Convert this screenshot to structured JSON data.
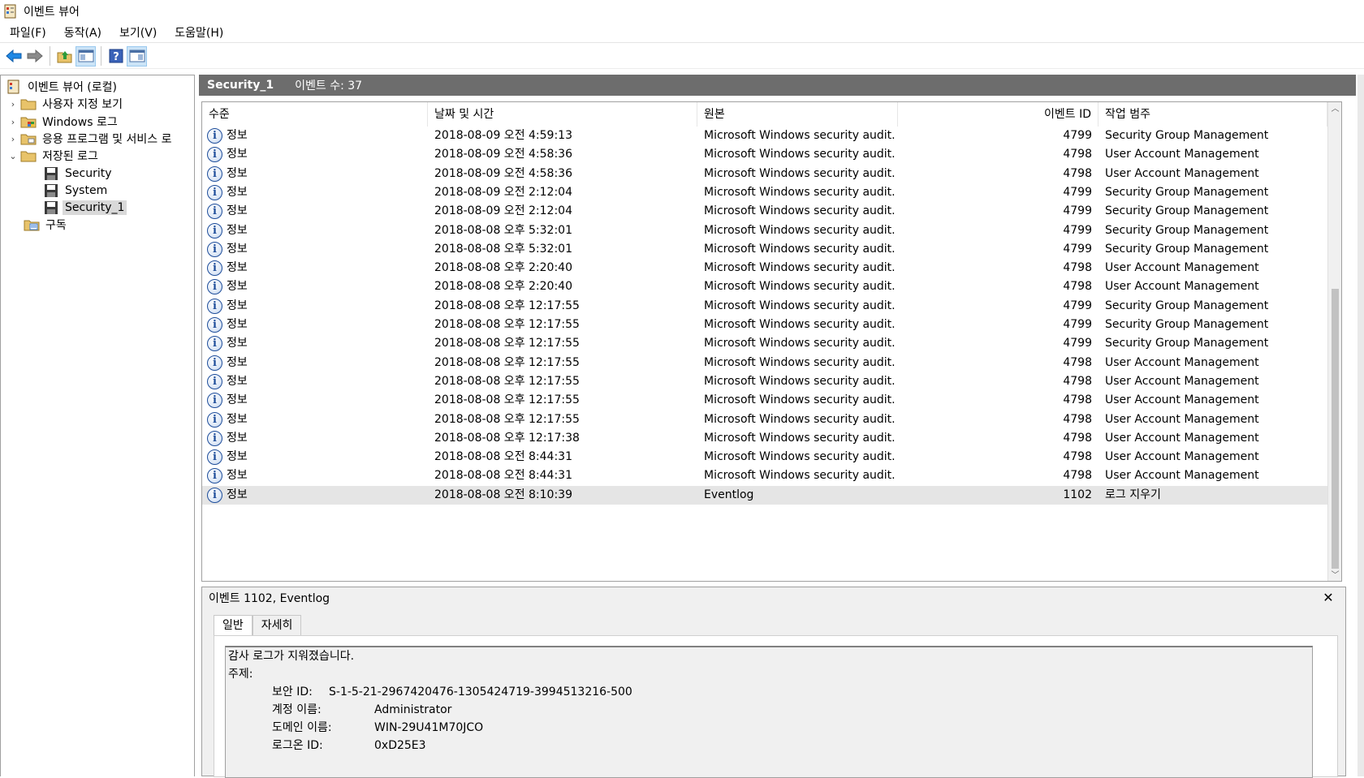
{
  "window": {
    "title": "이벤트 뷰어"
  },
  "menu": [
    "파일(F)",
    "동작(A)",
    "보기(V)",
    "도움말(H)"
  ],
  "tree": {
    "root": "이벤트 뷰어 (로컬)",
    "custom_views": "사용자 지정 보기",
    "windows_logs": "Windows 로그",
    "app_service_logs": "응용 프로그램 및 서비스 로",
    "saved_logs": "저장된 로그",
    "saved_items": [
      "Security",
      "System",
      "Security_1"
    ],
    "subscriptions": "구독"
  },
  "panel": {
    "name": "Security_1",
    "count_label": "이벤트 수: 37"
  },
  "columns": {
    "level": "수준",
    "datetime": "날짜 및 시간",
    "source": "원본",
    "event_id": "이벤트 ID",
    "category": "작업 범주"
  },
  "events": [
    {
      "level": "정보",
      "datetime": "2018-08-09 오전 4:59:13",
      "source": "Microsoft Windows security audit...",
      "event_id": "4799",
      "category": "Security Group Management"
    },
    {
      "level": "정보",
      "datetime": "2018-08-09 오전 4:58:36",
      "source": "Microsoft Windows security audit...",
      "event_id": "4798",
      "category": "User Account Management"
    },
    {
      "level": "정보",
      "datetime": "2018-08-09 오전 4:58:36",
      "source": "Microsoft Windows security audit...",
      "event_id": "4798",
      "category": "User Account Management"
    },
    {
      "level": "정보",
      "datetime": "2018-08-09 오전 2:12:04",
      "source": "Microsoft Windows security audit...",
      "event_id": "4799",
      "category": "Security Group Management"
    },
    {
      "level": "정보",
      "datetime": "2018-08-09 오전 2:12:04",
      "source": "Microsoft Windows security audit...",
      "event_id": "4799",
      "category": "Security Group Management"
    },
    {
      "level": "정보",
      "datetime": "2018-08-08 오후 5:32:01",
      "source": "Microsoft Windows security audit...",
      "event_id": "4799",
      "category": "Security Group Management"
    },
    {
      "level": "정보",
      "datetime": "2018-08-08 오후 5:32:01",
      "source": "Microsoft Windows security audit...",
      "event_id": "4799",
      "category": "Security Group Management"
    },
    {
      "level": "정보",
      "datetime": "2018-08-08 오후 2:20:40",
      "source": "Microsoft Windows security audit...",
      "event_id": "4798",
      "category": "User Account Management"
    },
    {
      "level": "정보",
      "datetime": "2018-08-08 오후 2:20:40",
      "source": "Microsoft Windows security audit...",
      "event_id": "4798",
      "category": "User Account Management"
    },
    {
      "level": "정보",
      "datetime": "2018-08-08 오후 12:17:55",
      "source": "Microsoft Windows security audit...",
      "event_id": "4799",
      "category": "Security Group Management"
    },
    {
      "level": "정보",
      "datetime": "2018-08-08 오후 12:17:55",
      "source": "Microsoft Windows security audit...",
      "event_id": "4799",
      "category": "Security Group Management"
    },
    {
      "level": "정보",
      "datetime": "2018-08-08 오후 12:17:55",
      "source": "Microsoft Windows security audit...",
      "event_id": "4799",
      "category": "Security Group Management"
    },
    {
      "level": "정보",
      "datetime": "2018-08-08 오후 12:17:55",
      "source": "Microsoft Windows security audit...",
      "event_id": "4798",
      "category": "User Account Management"
    },
    {
      "level": "정보",
      "datetime": "2018-08-08 오후 12:17:55",
      "source": "Microsoft Windows security audit...",
      "event_id": "4798",
      "category": "User Account Management"
    },
    {
      "level": "정보",
      "datetime": "2018-08-08 오후 12:17:55",
      "source": "Microsoft Windows security audit...",
      "event_id": "4798",
      "category": "User Account Management"
    },
    {
      "level": "정보",
      "datetime": "2018-08-08 오후 12:17:55",
      "source": "Microsoft Windows security audit...",
      "event_id": "4798",
      "category": "User Account Management"
    },
    {
      "level": "정보",
      "datetime": "2018-08-08 오후 12:17:38",
      "source": "Microsoft Windows security audit...",
      "event_id": "4798",
      "category": "User Account Management"
    },
    {
      "level": "정보",
      "datetime": "2018-08-08 오전 8:44:31",
      "source": "Microsoft Windows security audit...",
      "event_id": "4798",
      "category": "User Account Management"
    },
    {
      "level": "정보",
      "datetime": "2018-08-08 오전 8:44:31",
      "source": "Microsoft Windows security audit...",
      "event_id": "4798",
      "category": "User Account Management"
    },
    {
      "level": "정보",
      "datetime": "2018-08-08 오전 8:10:39",
      "source": "Eventlog",
      "event_id": "1102",
      "category": "로그 지우기"
    }
  ],
  "detail": {
    "title": "이벤트 1102, Eventlog",
    "tabs": [
      "일반",
      "자세히"
    ],
    "message": "감사 로그가 지워졌습니다.",
    "subject_label": "주제:",
    "fields": [
      {
        "label": "보안 ID:",
        "value": "S-1-5-21-2967420476-1305424719-3994513216-500"
      },
      {
        "label": "계정 이름:",
        "value": "Administrator"
      },
      {
        "label": "도메인 이름:",
        "value": "WIN-29U41M70JCO"
      },
      {
        "label": "로그온 ID:",
        "value": "0xD25E3"
      }
    ]
  },
  "colors": {
    "panel_header": "#6d6d6d",
    "selected_row": "#e5e5e5",
    "info_icon": "#1f4e9b"
  }
}
